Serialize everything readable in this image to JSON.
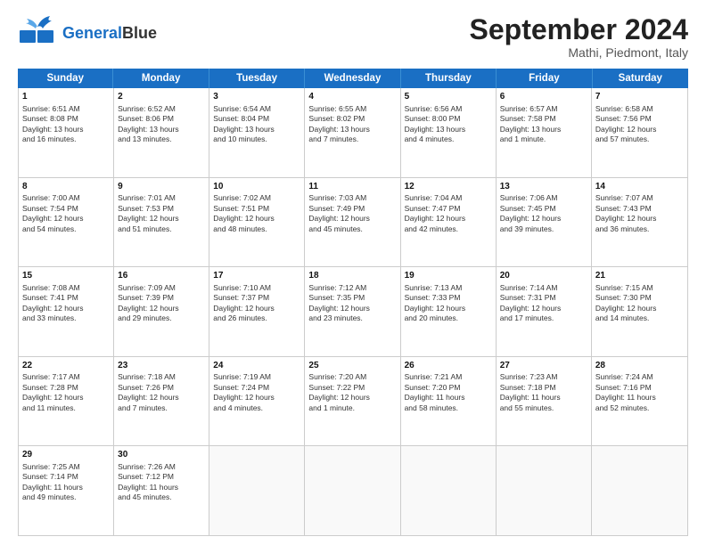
{
  "header": {
    "logo_line1": "General",
    "logo_line2": "Blue",
    "month_title": "September 2024",
    "location": "Mathi, Piedmont, Italy"
  },
  "weekdays": [
    "Sunday",
    "Monday",
    "Tuesday",
    "Wednesday",
    "Thursday",
    "Friday",
    "Saturday"
  ],
  "rows": [
    [
      {
        "day": "1",
        "lines": [
          "Sunrise: 6:51 AM",
          "Sunset: 8:08 PM",
          "Daylight: 13 hours",
          "and 16 minutes."
        ]
      },
      {
        "day": "2",
        "lines": [
          "Sunrise: 6:52 AM",
          "Sunset: 8:06 PM",
          "Daylight: 13 hours",
          "and 13 minutes."
        ]
      },
      {
        "day": "3",
        "lines": [
          "Sunrise: 6:54 AM",
          "Sunset: 8:04 PM",
          "Daylight: 13 hours",
          "and 10 minutes."
        ]
      },
      {
        "day": "4",
        "lines": [
          "Sunrise: 6:55 AM",
          "Sunset: 8:02 PM",
          "Daylight: 13 hours",
          "and 7 minutes."
        ]
      },
      {
        "day": "5",
        "lines": [
          "Sunrise: 6:56 AM",
          "Sunset: 8:00 PM",
          "Daylight: 13 hours",
          "and 4 minutes."
        ]
      },
      {
        "day": "6",
        "lines": [
          "Sunrise: 6:57 AM",
          "Sunset: 7:58 PM",
          "Daylight: 13 hours",
          "and 1 minute."
        ]
      },
      {
        "day": "7",
        "lines": [
          "Sunrise: 6:58 AM",
          "Sunset: 7:56 PM",
          "Daylight: 12 hours",
          "and 57 minutes."
        ]
      }
    ],
    [
      {
        "day": "8",
        "lines": [
          "Sunrise: 7:00 AM",
          "Sunset: 7:54 PM",
          "Daylight: 12 hours",
          "and 54 minutes."
        ]
      },
      {
        "day": "9",
        "lines": [
          "Sunrise: 7:01 AM",
          "Sunset: 7:53 PM",
          "Daylight: 12 hours",
          "and 51 minutes."
        ]
      },
      {
        "day": "10",
        "lines": [
          "Sunrise: 7:02 AM",
          "Sunset: 7:51 PM",
          "Daylight: 12 hours",
          "and 48 minutes."
        ]
      },
      {
        "day": "11",
        "lines": [
          "Sunrise: 7:03 AM",
          "Sunset: 7:49 PM",
          "Daylight: 12 hours",
          "and 45 minutes."
        ]
      },
      {
        "day": "12",
        "lines": [
          "Sunrise: 7:04 AM",
          "Sunset: 7:47 PM",
          "Daylight: 12 hours",
          "and 42 minutes."
        ]
      },
      {
        "day": "13",
        "lines": [
          "Sunrise: 7:06 AM",
          "Sunset: 7:45 PM",
          "Daylight: 12 hours",
          "and 39 minutes."
        ]
      },
      {
        "day": "14",
        "lines": [
          "Sunrise: 7:07 AM",
          "Sunset: 7:43 PM",
          "Daylight: 12 hours",
          "and 36 minutes."
        ]
      }
    ],
    [
      {
        "day": "15",
        "lines": [
          "Sunrise: 7:08 AM",
          "Sunset: 7:41 PM",
          "Daylight: 12 hours",
          "and 33 minutes."
        ]
      },
      {
        "day": "16",
        "lines": [
          "Sunrise: 7:09 AM",
          "Sunset: 7:39 PM",
          "Daylight: 12 hours",
          "and 29 minutes."
        ]
      },
      {
        "day": "17",
        "lines": [
          "Sunrise: 7:10 AM",
          "Sunset: 7:37 PM",
          "Daylight: 12 hours",
          "and 26 minutes."
        ]
      },
      {
        "day": "18",
        "lines": [
          "Sunrise: 7:12 AM",
          "Sunset: 7:35 PM",
          "Daylight: 12 hours",
          "and 23 minutes."
        ]
      },
      {
        "day": "19",
        "lines": [
          "Sunrise: 7:13 AM",
          "Sunset: 7:33 PM",
          "Daylight: 12 hours",
          "and 20 minutes."
        ]
      },
      {
        "day": "20",
        "lines": [
          "Sunrise: 7:14 AM",
          "Sunset: 7:31 PM",
          "Daylight: 12 hours",
          "and 17 minutes."
        ]
      },
      {
        "day": "21",
        "lines": [
          "Sunrise: 7:15 AM",
          "Sunset: 7:30 PM",
          "Daylight: 12 hours",
          "and 14 minutes."
        ]
      }
    ],
    [
      {
        "day": "22",
        "lines": [
          "Sunrise: 7:17 AM",
          "Sunset: 7:28 PM",
          "Daylight: 12 hours",
          "and 11 minutes."
        ]
      },
      {
        "day": "23",
        "lines": [
          "Sunrise: 7:18 AM",
          "Sunset: 7:26 PM",
          "Daylight: 12 hours",
          "and 7 minutes."
        ]
      },
      {
        "day": "24",
        "lines": [
          "Sunrise: 7:19 AM",
          "Sunset: 7:24 PM",
          "Daylight: 12 hours",
          "and 4 minutes."
        ]
      },
      {
        "day": "25",
        "lines": [
          "Sunrise: 7:20 AM",
          "Sunset: 7:22 PM",
          "Daylight: 12 hours",
          "and 1 minute."
        ]
      },
      {
        "day": "26",
        "lines": [
          "Sunrise: 7:21 AM",
          "Sunset: 7:20 PM",
          "Daylight: 11 hours",
          "and 58 minutes."
        ]
      },
      {
        "day": "27",
        "lines": [
          "Sunrise: 7:23 AM",
          "Sunset: 7:18 PM",
          "Daylight: 11 hours",
          "and 55 minutes."
        ]
      },
      {
        "day": "28",
        "lines": [
          "Sunrise: 7:24 AM",
          "Sunset: 7:16 PM",
          "Daylight: 11 hours",
          "and 52 minutes."
        ]
      }
    ],
    [
      {
        "day": "29",
        "lines": [
          "Sunrise: 7:25 AM",
          "Sunset: 7:14 PM",
          "Daylight: 11 hours",
          "and 49 minutes."
        ]
      },
      {
        "day": "30",
        "lines": [
          "Sunrise: 7:26 AM",
          "Sunset: 7:12 PM",
          "Daylight: 11 hours",
          "and 45 minutes."
        ]
      },
      {
        "day": "",
        "lines": []
      },
      {
        "day": "",
        "lines": []
      },
      {
        "day": "",
        "lines": []
      },
      {
        "day": "",
        "lines": []
      },
      {
        "day": "",
        "lines": []
      }
    ]
  ]
}
